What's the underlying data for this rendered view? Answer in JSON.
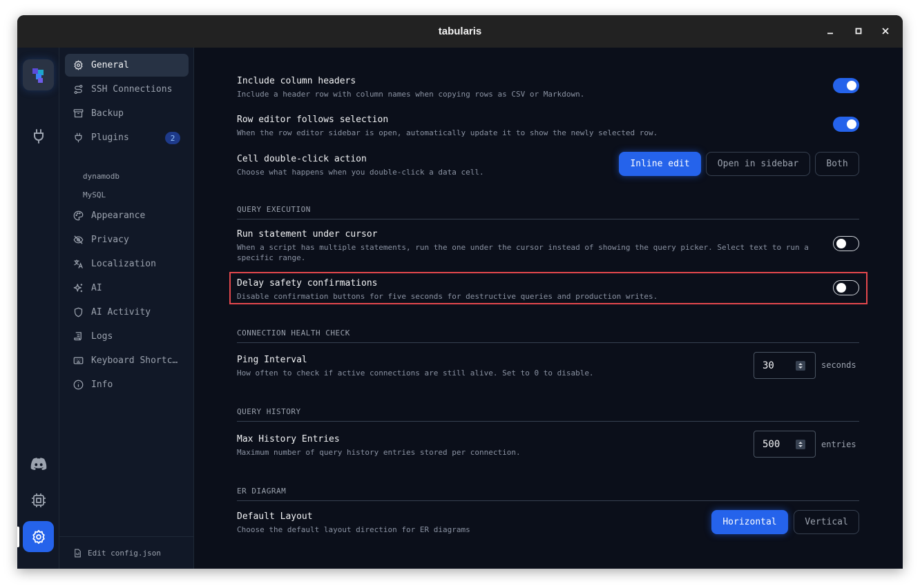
{
  "window": {
    "title": "tabularis"
  },
  "sidebar": {
    "items": [
      {
        "label": "General",
        "icon": "gear-icon",
        "active": true
      },
      {
        "label": "SSH Connections",
        "icon": "ssh-route-icon"
      },
      {
        "label": "Backup",
        "icon": "archive-icon"
      },
      {
        "label": "Plugins",
        "icon": "plug-icon",
        "badge": "2"
      },
      {
        "label": "Appearance",
        "icon": "palette-icon"
      },
      {
        "label": "Privacy",
        "icon": "eye-off-icon"
      },
      {
        "label": "Localization",
        "icon": "languages-icon"
      },
      {
        "label": "AI",
        "icon": "sparkles-icon"
      },
      {
        "label": "AI Activity",
        "icon": "shield-icon"
      },
      {
        "label": "Logs",
        "icon": "scroll-icon"
      },
      {
        "label": "Keyboard Shortcuts",
        "icon": "keyboard-icon"
      },
      {
        "label": "Info",
        "icon": "info-icon"
      }
    ],
    "plugins": [
      "dynamodb",
      "MySQL"
    ],
    "footer": "Edit config.json"
  },
  "settings": {
    "include_headers": {
      "title": "Include column headers",
      "desc": "Include a header row with column names when copying rows as CSV or Markdown.",
      "enabled": true
    },
    "row_editor": {
      "title": "Row editor follows selection",
      "desc": "When the row editor sidebar is open, automatically update it to show the newly selected row.",
      "enabled": true
    },
    "double_click": {
      "title": "Cell double-click action",
      "desc": "Choose what happens when you double-click a data cell.",
      "options": [
        "Inline edit",
        "Open in sidebar",
        "Both"
      ],
      "selected": "Inline edit"
    },
    "query_execution": {
      "header": "QUERY EXECUTION",
      "run_under_cursor": {
        "title": "Run statement under cursor",
        "desc": "When a script has multiple statements, run the one under the cursor instead of showing the query picker. Select text to run a specific range.",
        "enabled": false
      },
      "delay_confirm": {
        "title": "Delay safety confirmations",
        "desc": "Disable confirmation buttons for five seconds for destructive queries and production writes.",
        "enabled": false
      }
    },
    "health_check": {
      "header": "CONNECTION HEALTH CHECK",
      "ping": {
        "title": "Ping Interval",
        "desc": "How often to check if active connections are still alive. Set to 0 to disable.",
        "value": "30",
        "unit": "seconds"
      }
    },
    "query_history": {
      "header": "QUERY HISTORY",
      "max": {
        "title": "Max History Entries",
        "desc": "Maximum number of query history entries stored per connection.",
        "value": "500",
        "unit": "entries"
      }
    },
    "er_diagram": {
      "header": "ER DIAGRAM",
      "layout": {
        "title": "Default Layout",
        "desc": "Choose the default layout direction for ER diagrams",
        "options": [
          "Horizontal",
          "Vertical"
        ],
        "selected": "Horizontal"
      }
    }
  },
  "colors": {
    "accent": "#2563eb",
    "highlight": "#e5484d",
    "background": "#0b0f1a"
  }
}
